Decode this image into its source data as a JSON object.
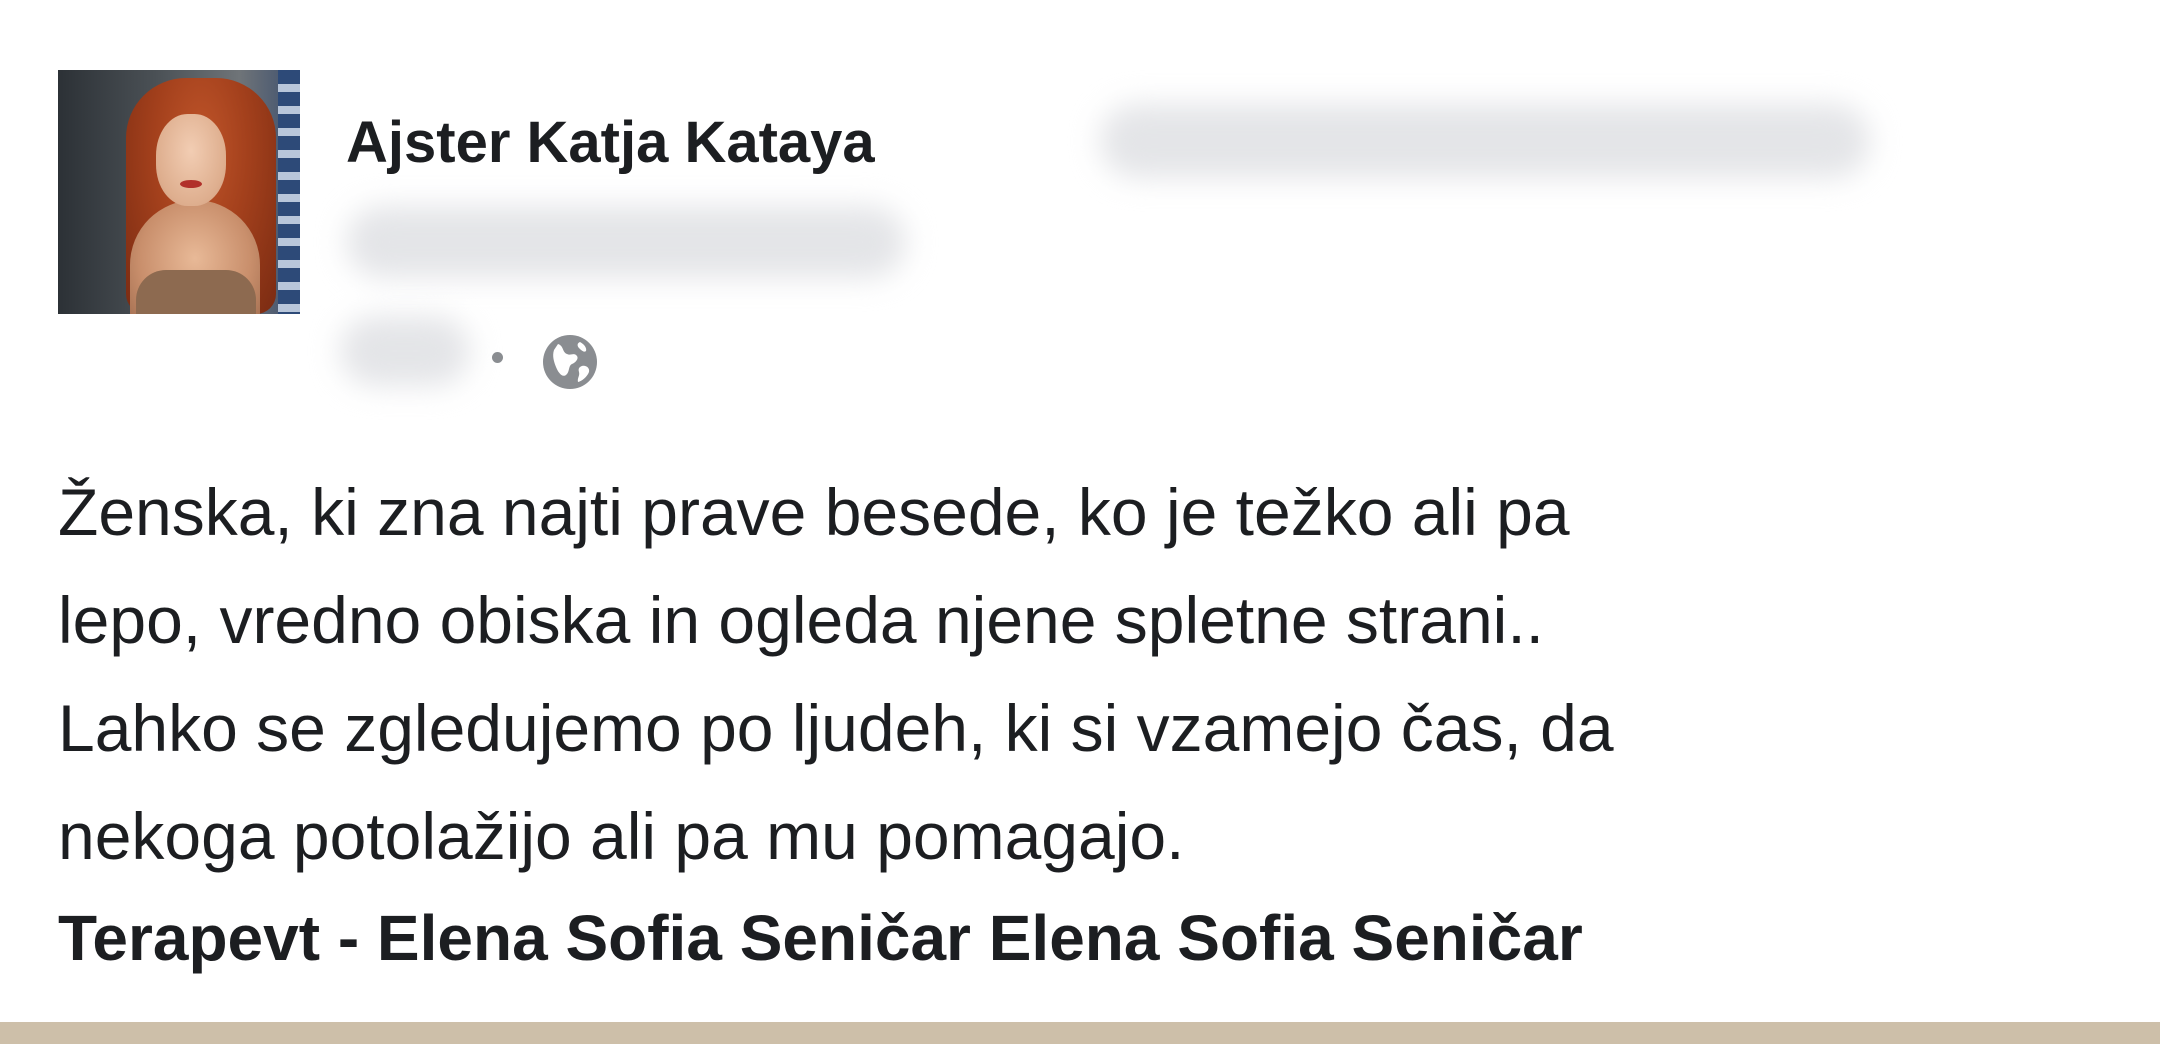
{
  "post": {
    "author_name": "Ajster Katja Kataya",
    "privacy_icon": "globe-icon",
    "body_lines": [
      "Ženska, ki zna najti prave besede, ko je težko ali pa",
      "lepo, vredno obiska in ogleda njene spletne strani..",
      "Lahko se zgledujemo po ljudeh, ki si vzamejo čas, da",
      "nekoga potolažijo ali pa mu pomagajo."
    ],
    "signature": "Terapevt - Elena Sofia Seničar Elena Sofia Seničar"
  },
  "colors": {
    "text": "#1c1e21",
    "meta_gray": "#8a8d91",
    "bottom_bar": "#cdbfa9"
  }
}
